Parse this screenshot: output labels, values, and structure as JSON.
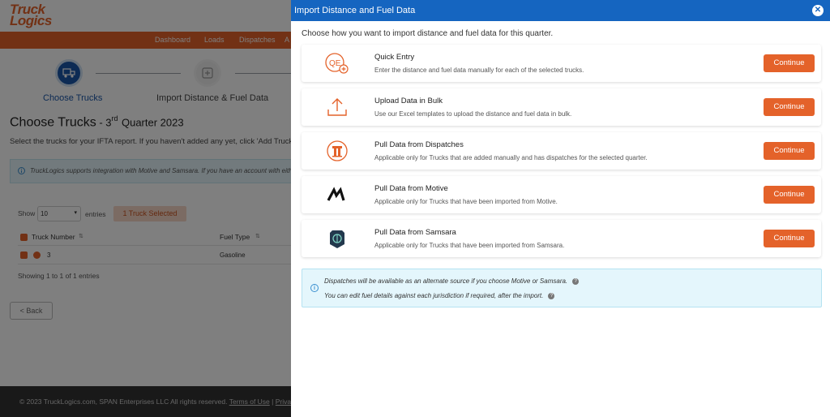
{
  "app": {
    "logo_text_line1": "Truck",
    "logo_text_line2": "Logics"
  },
  "nav": {
    "items": [
      "Dashboard",
      "Loads",
      "Dispatches",
      "A"
    ]
  },
  "stepper": {
    "steps": [
      {
        "label": "Choose Trucks",
        "active": true
      },
      {
        "label": "Import Distance & Fuel Data",
        "active": false
      }
    ]
  },
  "page": {
    "title": "Choose Trucks",
    "title_sep": " - ",
    "quarter_num": "3",
    "quarter_sup": "rd",
    "quarter_rest": "Quarter 2023",
    "description": "Select the trucks for your IFTA report. If you haven't added any yet, click 'Add Trucks' to",
    "integration_info": "TruckLogics supports integration with Motive and Samsara. If you have an account with either of",
    "show_label": "Show",
    "entries_value": "10",
    "entries_label": "entries",
    "selected_badge": "1 Truck Selected",
    "columns": [
      "Truck Number",
      "Fuel Type"
    ],
    "rows": [
      {
        "truck_number": "3",
        "fuel_type": "Gasoline"
      }
    ],
    "showing_text": "Showing 1 to 1 of 1 entries",
    "back_label": "< Back"
  },
  "footer": {
    "copyright": "© 2023 TruckLogics.com, SPAN Enterprises LLC All rights reserved.",
    "terms": "Terms of Use",
    "sep": "|",
    "privacy": "Privacy Poli"
  },
  "drawer": {
    "title": "Import Distance and Fuel Data",
    "close_glyph": "✕",
    "intro": "Choose how you want to import distance and fuel data for this quarter.",
    "options": [
      {
        "icon": "quick-entry-icon",
        "title": "Quick Entry",
        "description": "Enter the distance and fuel data manually for each of the selected trucks.",
        "button": "Continue"
      },
      {
        "icon": "upload-icon",
        "title": "Upload Data in Bulk",
        "description": "Use our Excel templates to upload the distance and fuel data in bulk.",
        "button": "Continue"
      },
      {
        "icon": "dispatches-icon",
        "title": "Pull Data from Dispatches",
        "description": "Applicable only for Trucks that are added manually and has dispatches for the selected quarter.",
        "button": "Continue"
      },
      {
        "icon": "motive-logo-icon",
        "title": "Pull Data from Motive",
        "description": "Applicable only for Trucks that have been imported from Motive.",
        "button": "Continue"
      },
      {
        "icon": "samsara-logo-icon",
        "title": "Pull Data from Samsara",
        "description": "Applicable only for Trucks that have been imported from Samsara.",
        "button": "Continue"
      }
    ],
    "notes": [
      "Dispatches will be available as an alternate source if you choose Motive or Samsara.",
      "You can edit fuel details against each jurisdiction if required, after the import."
    ]
  },
  "colors": {
    "brand_orange": "#e4622a",
    "header_blue": "#1565c0",
    "note_bg": "#e4f6fc"
  }
}
